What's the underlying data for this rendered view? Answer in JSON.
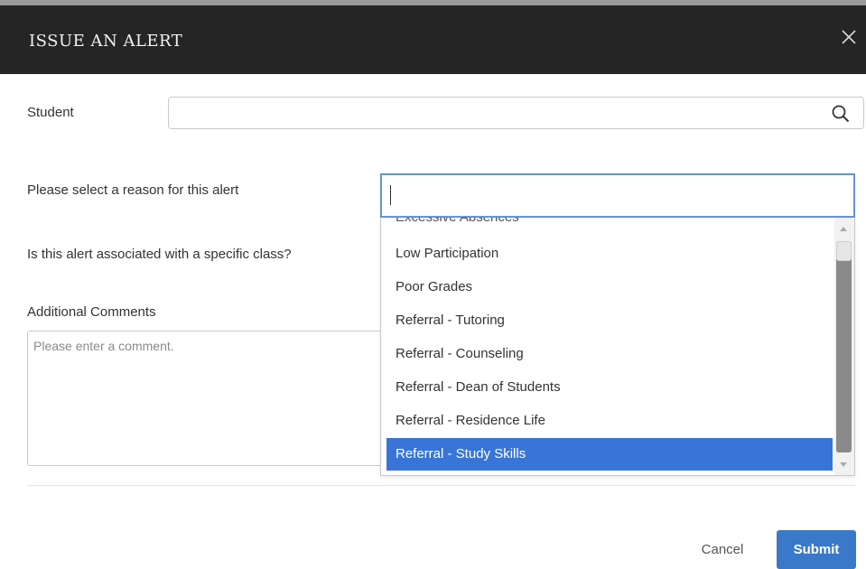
{
  "dialog": {
    "title": "ISSUE AN ALERT"
  },
  "form": {
    "student_label": "Student",
    "student_value": "",
    "reason_label": "Please select a reason for this alert",
    "reason_value": "",
    "class_label": "Is this alert associated with a specific class?",
    "comments_label": "Additional Comments",
    "comments_placeholder": "Please enter a comment."
  },
  "dropdown": {
    "options": [
      "Excessive Absences",
      "Low Participation",
      "Poor Grades",
      "Referral - Tutoring",
      "Referral - Counseling",
      "Referral - Dean of Students",
      "Referral - Residence Life",
      "Referral - Study Skills"
    ],
    "highlighted": "Referral - Study Skills"
  },
  "footer": {
    "cancel_label": "Cancel",
    "submit_label": "Submit"
  },
  "icons": {
    "close": "close-icon",
    "search": "search-icon"
  },
  "colors": {
    "header_bg": "#252525",
    "accent": "#3a78c9",
    "highlight": "#3875d7"
  }
}
